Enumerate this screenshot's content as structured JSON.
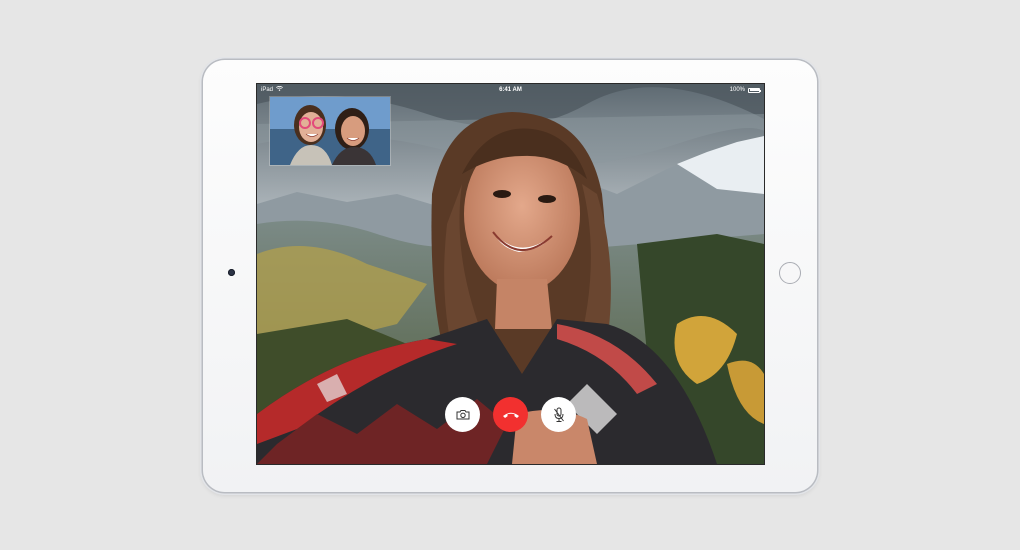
{
  "status_bar": {
    "carrier": "iPad",
    "wifi_icon": "wifi-icon",
    "time": "6:41 AM",
    "battery_percent": "100%",
    "battery_level": 1.0
  },
  "call": {
    "controls": [
      {
        "name": "flip-camera-button",
        "icon": "camera-icon"
      },
      {
        "name": "end-call-button",
        "icon": "phone-hangup-icon",
        "color": "#f2302f"
      },
      {
        "name": "mute-button",
        "icon": "microphone-muted-icon"
      }
    ]
  },
  "colors": {
    "end_call_red": "#f2302f",
    "background": "#e6e6e6",
    "device_body": "#f5f5f6"
  }
}
